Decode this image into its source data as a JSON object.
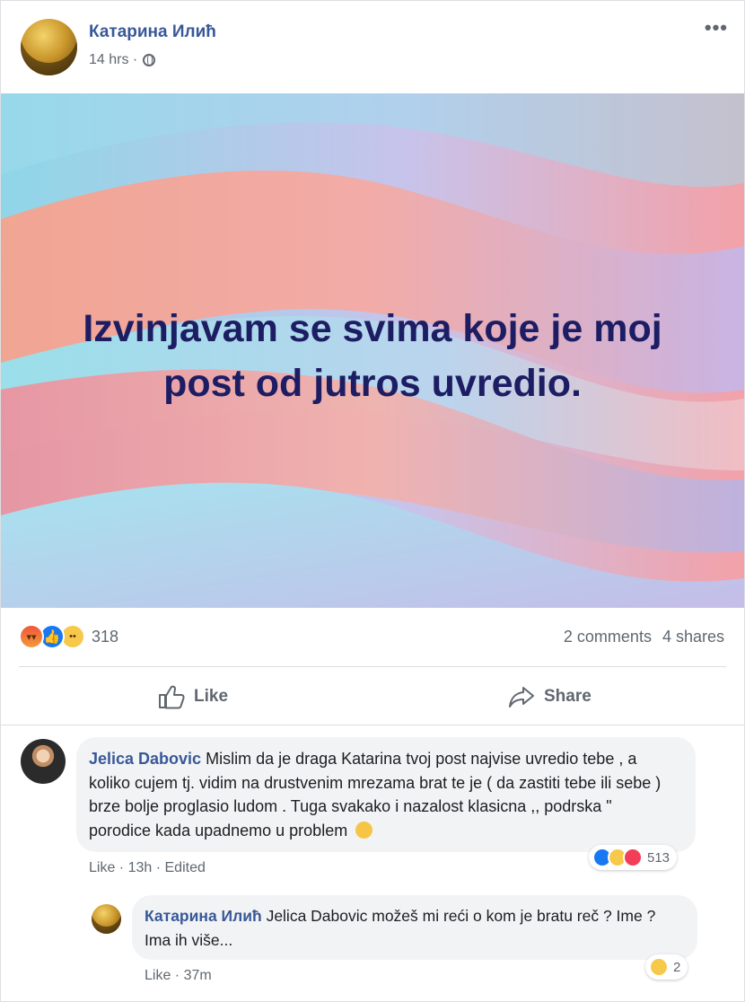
{
  "post": {
    "author": "Катарина Илић",
    "time": "14 hrs ·",
    "privacy_icon": "globe-icon",
    "more_label": "•••",
    "text_line1": "Izvinjavam se svima koje je moj",
    "text_line2": "post od jutros uvredio."
  },
  "reactions": {
    "count": "318",
    "types": [
      "angry",
      "like",
      "sad"
    ],
    "comments": "2 comments",
    "shares": "4 shares"
  },
  "actions": {
    "like": "Like",
    "share": "Share"
  },
  "comments": [
    {
      "author": "Jelica Dabovic",
      "text": "Mislim da je draga Katarina tvoj post najvise uvredio tebe , a koliko cujem tj. vidim na drustvenim mrezama brat te je ( da zastiti tebe ili sebe ) brze bolje proglasio ludom . Tuga svakako i nazalost klasicna ,, podrska \" porodice kada upadnemo u problem",
      "like": "Like",
      "time": "13h",
      "edited": "Edited",
      "reaction_count": "513"
    },
    {
      "author": "Катарина Илић",
      "text": "Jelica Dabovic možeš mi reći o kom je bratu reč ? Ime ? Ima ih više...",
      "like": "Like",
      "time": "37m",
      "reaction_count": "2"
    }
  ],
  "colors": {
    "link": "#385898",
    "meta": "#606770",
    "hero_text": "#1d1d64",
    "bubble": "#f2f3f5"
  }
}
